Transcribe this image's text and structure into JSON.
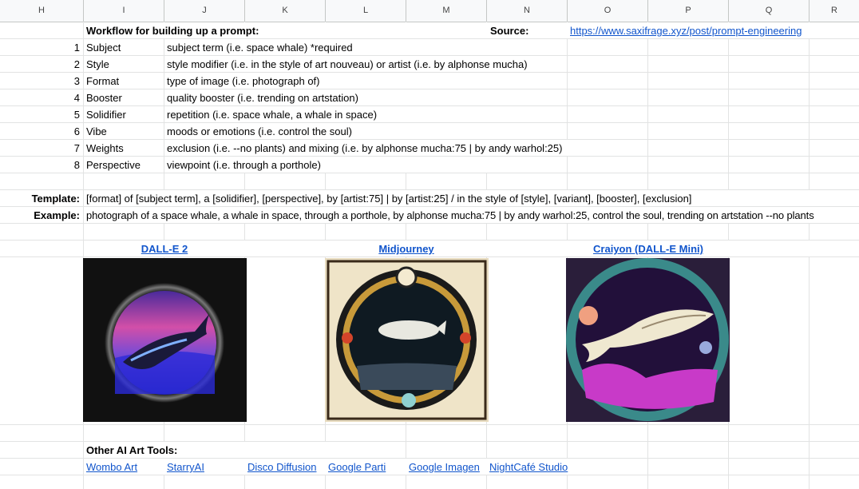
{
  "columns": [
    "H",
    "I",
    "J",
    "K",
    "L",
    "M",
    "N",
    "O",
    "P",
    "Q",
    "R"
  ],
  "workflow": {
    "title": "Workflow for building up a prompt:",
    "source_label": "Source:",
    "source_link": "https://www.saxifrage.xyz/post/prompt-engineering",
    "rows": [
      {
        "num": "1",
        "name": "Subject",
        "desc": "subject term (i.e. space whale) *required"
      },
      {
        "num": "2",
        "name": "Style",
        "desc": "style modifier (i.e. in the style of art nouveau) or artist (i.e. by alphonse mucha)"
      },
      {
        "num": "3",
        "name": "Format",
        "desc": "type of image (i.e. photograph of)"
      },
      {
        "num": "4",
        "name": "Booster",
        "desc": "quality booster (i.e. trending on artstation)"
      },
      {
        "num": "5",
        "name": "Solidifier",
        "desc": "repetition (i.e. space whale, a whale in space)"
      },
      {
        "num": "6",
        "name": "Vibe",
        "desc": "moods or emotions (i.e. control the soul)"
      },
      {
        "num": "7",
        "name": "Weights",
        "desc": "exclusion (i.e. --no plants) and mixing (i.e. by alphonse mucha:75 | by andy warhol:25)"
      },
      {
        "num": "8",
        "name": "Perspective",
        "desc": "viewpoint (i.e. through a porthole)"
      }
    ]
  },
  "template": {
    "label": "Template:",
    "value": "[format] of [subject term], a [solidifier], [perspective], by [artist:75] | by [artist:25] / in the style of [style], [variant], [booster], [exclusion]"
  },
  "example": {
    "label": "Example:",
    "value": "photograph of a space whale, a whale in space, through a porthole, by alphonse mucha:75 | by andy warhol:25, control the soul, trending on artstation --no plants"
  },
  "tools": [
    {
      "name": "DALL-E 2"
    },
    {
      "name": "Midjourney"
    },
    {
      "name": "Craiyon (DALL-E Mini)"
    }
  ],
  "other_tools": {
    "title": "Other AI Art Tools:",
    "links": [
      "Wombo Art",
      "StarryAI",
      "Disco Diffusion",
      "Google Parti",
      "Google Imagen",
      "NightCafé Studio"
    ]
  }
}
